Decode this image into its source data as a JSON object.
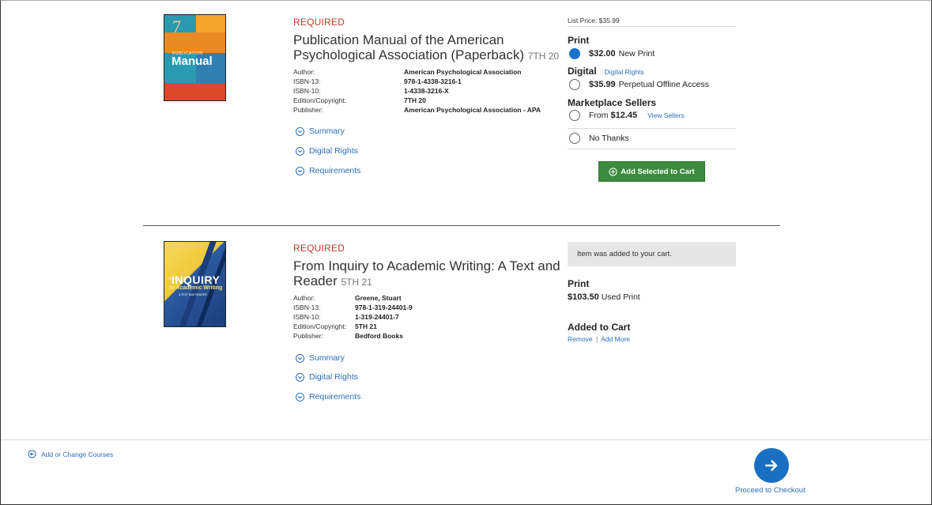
{
  "items": [
    {
      "required": "REQUIRED",
      "title": "Publication Manual of the American Psychological Association (Paperback)",
      "edition_tag": "7TH 20",
      "meta": [
        {
          "label": "Author:",
          "value": "American Psychological Association"
        },
        {
          "label": "ISBN-13:",
          "value": "978-1-4338-3216-1"
        },
        {
          "label": "ISBN-10:",
          "value": "1-4338-3216-X"
        },
        {
          "label": "Edition/Copyright:",
          "value": "7TH 20"
        },
        {
          "label": "Publisher:",
          "value": "American Psychological Association - APA"
        }
      ],
      "expanders": [
        "Summary",
        "Digital Rights",
        "Requirements"
      ],
      "cover": {
        "line1": "PUBLICATION",
        "line2": "Manual",
        "number": "7",
        "colors": [
          "#e94f2e",
          "#f39c2b",
          "#2a9ab0",
          "#2f6fa7"
        ]
      },
      "purchase": {
        "list_price": "List Price: $35.99",
        "print_heading": "Print",
        "print_price": "$32.00",
        "print_desc": "New Print",
        "digital_heading": "Digital",
        "digital_rights_link": "Digital Rights",
        "digital_price": "$35.99",
        "digital_desc": "Perpetual Offline Access",
        "marketplace_heading": "Marketplace Sellers",
        "marketplace_from": "From",
        "marketplace_price": "$12.45",
        "view_sellers": "View Sellers",
        "no_thanks": "No Thanks",
        "add_button": "Add Selected to Cart"
      }
    },
    {
      "required": "REQUIRED",
      "title": "From Inquiry to Academic Writing: A Text and Reader",
      "edition_tag": "5TH 21",
      "meta": [
        {
          "label": "Author:",
          "value": "Greene, Stuart"
        },
        {
          "label": "ISBN-13:",
          "value": "978-1-319-24401-9"
        },
        {
          "label": "ISBN-10:",
          "value": "1-319-24401-7"
        },
        {
          "label": "Edition/Copyright:",
          "value": "5TH 21"
        },
        {
          "label": "Publisher:",
          "value": "Bedford Books"
        }
      ],
      "expanders": [
        "Summary",
        "Digital Rights",
        "Requirements"
      ],
      "cover": {
        "line1": "FROM",
        "line2": "INQUIRY",
        "line3": "to Academic Writing",
        "line4": "A TEXT AND READER",
        "colors": [
          "#f2d34a",
          "#2c5aa0",
          "#1c3d7a"
        ]
      },
      "cart": {
        "notice": "Item was added to your cart.",
        "print_heading": "Print",
        "price": "$103.50",
        "desc": "Used Print",
        "added_heading": "Added to Cart",
        "remove": "Remove",
        "separator": "|",
        "add_more": "Add More"
      }
    }
  ],
  "footer": {
    "add_courses": "Add or Change Courses",
    "checkout": "Proceed to Checkout"
  },
  "colors": {
    "link": "#2a6ebb",
    "required": "#c0392b",
    "accent_blue": "#1a73c9",
    "button_green": "#3c8c3f"
  }
}
